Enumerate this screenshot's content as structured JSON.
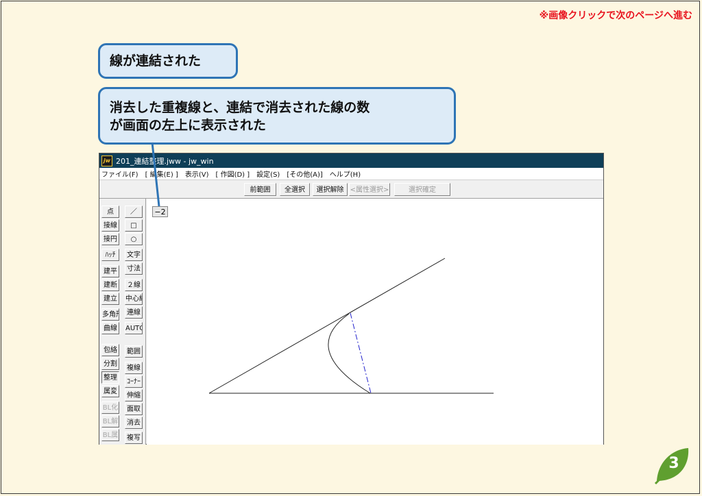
{
  "nav_hint": "※画像クリックで次のページへ進む",
  "callouts": {
    "first": "線が連結された",
    "second_line1": "消去した重複線と、連結で消去された線の数",
    "second_line2": "が画面の左上に表示された"
  },
  "window": {
    "title": "201_連結整理.jww - jw_win",
    "app_icon": "jw"
  },
  "menu": [
    "ファイル(F)",
    "[ 編集(E) ]",
    "表示(V)",
    "[ 作図(D) ]",
    "設定(S)",
    "[その他(A)]",
    "ヘルプ(H)"
  ],
  "toolbar": {
    "prev_range": "前範囲",
    "select_all": "全選択",
    "deselect": "選択解除",
    "attr_select": "<属性選択>",
    "confirm_select": "選択確定"
  },
  "tools_left_col": [
    "点",
    "接線",
    "接円",
    "ﾊｯﾁ",
    "建平",
    "建断",
    "建立",
    "多角形",
    "曲線",
    "包絡",
    "分割",
    "整理",
    "属変",
    "BL化",
    "BL解",
    "BL属"
  ],
  "tools_right_col": [
    "／",
    "□",
    "○",
    "文字",
    "寸法",
    "２線",
    "中心線",
    "連線",
    "AUTO",
    "範囲",
    "複線",
    "ｺｰﾅｰ",
    "伸縮",
    "面取",
    "消去",
    "複写"
  ],
  "status_count": "−2",
  "page_number": "3",
  "colors": {
    "background": "#fdf7e1",
    "nav_hint": "#e8141f",
    "callout_fill": "#ddebf7",
    "callout_border": "#2e74b5",
    "titlebar": "#0f3f58",
    "badge": "#5f9f2f",
    "dashed_line": "#2222cc"
  }
}
